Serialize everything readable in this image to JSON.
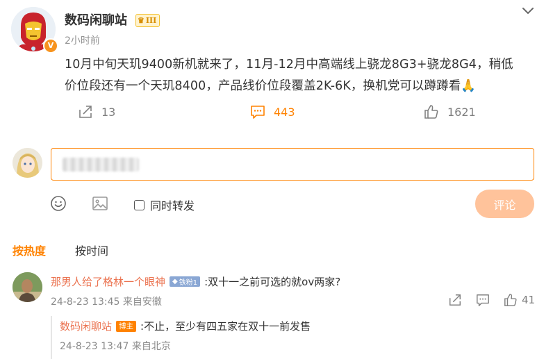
{
  "post": {
    "author": "数码闲聊站",
    "level_badge": "III",
    "time": "2小时前",
    "text_line1": "10月中旬天玑9400新机就来了，11月-12月中高端线上骁龙8G3+骁龙8G4，稍低",
    "text_line2": "价位段还有一个天玑8400，产品线价位段覆盖2K-6K，换机党可以蹲蹲看",
    "emoji": "🙏",
    "reposts": "13",
    "comments": "443",
    "likes": "1621",
    "verified_mark": "V"
  },
  "composer": {
    "also_repost_label": "同时转发",
    "submit_label": "评论"
  },
  "sort_tabs": {
    "hot": "按热度",
    "time": "按时间"
  },
  "comments": [
    {
      "user": "那男人给了格林一个眼神",
      "fan_badge": "铁粉1",
      "text": ":双十一之前可选的就ov两家?",
      "time": "24-8-23 13:45",
      "source": "来自安徽",
      "likes": "41"
    }
  ],
  "reply": {
    "user": "数码闲聊站",
    "tag": "博主",
    "text": ":不止，至少有四五家在双十一前发售",
    "time": "24-8-23 13:47",
    "source": "来自北京"
  },
  "icons": {
    "more": "chevron-down-icon",
    "repost": "repost-icon",
    "comment": "comment-icon",
    "like": "thumbs-up-icon",
    "emoji": "smiley-icon",
    "image": "image-icon"
  },
  "colors": {
    "accent": "#ff8200",
    "comment_username": "#eb7350",
    "submit_disabled": "#ffc39b"
  }
}
